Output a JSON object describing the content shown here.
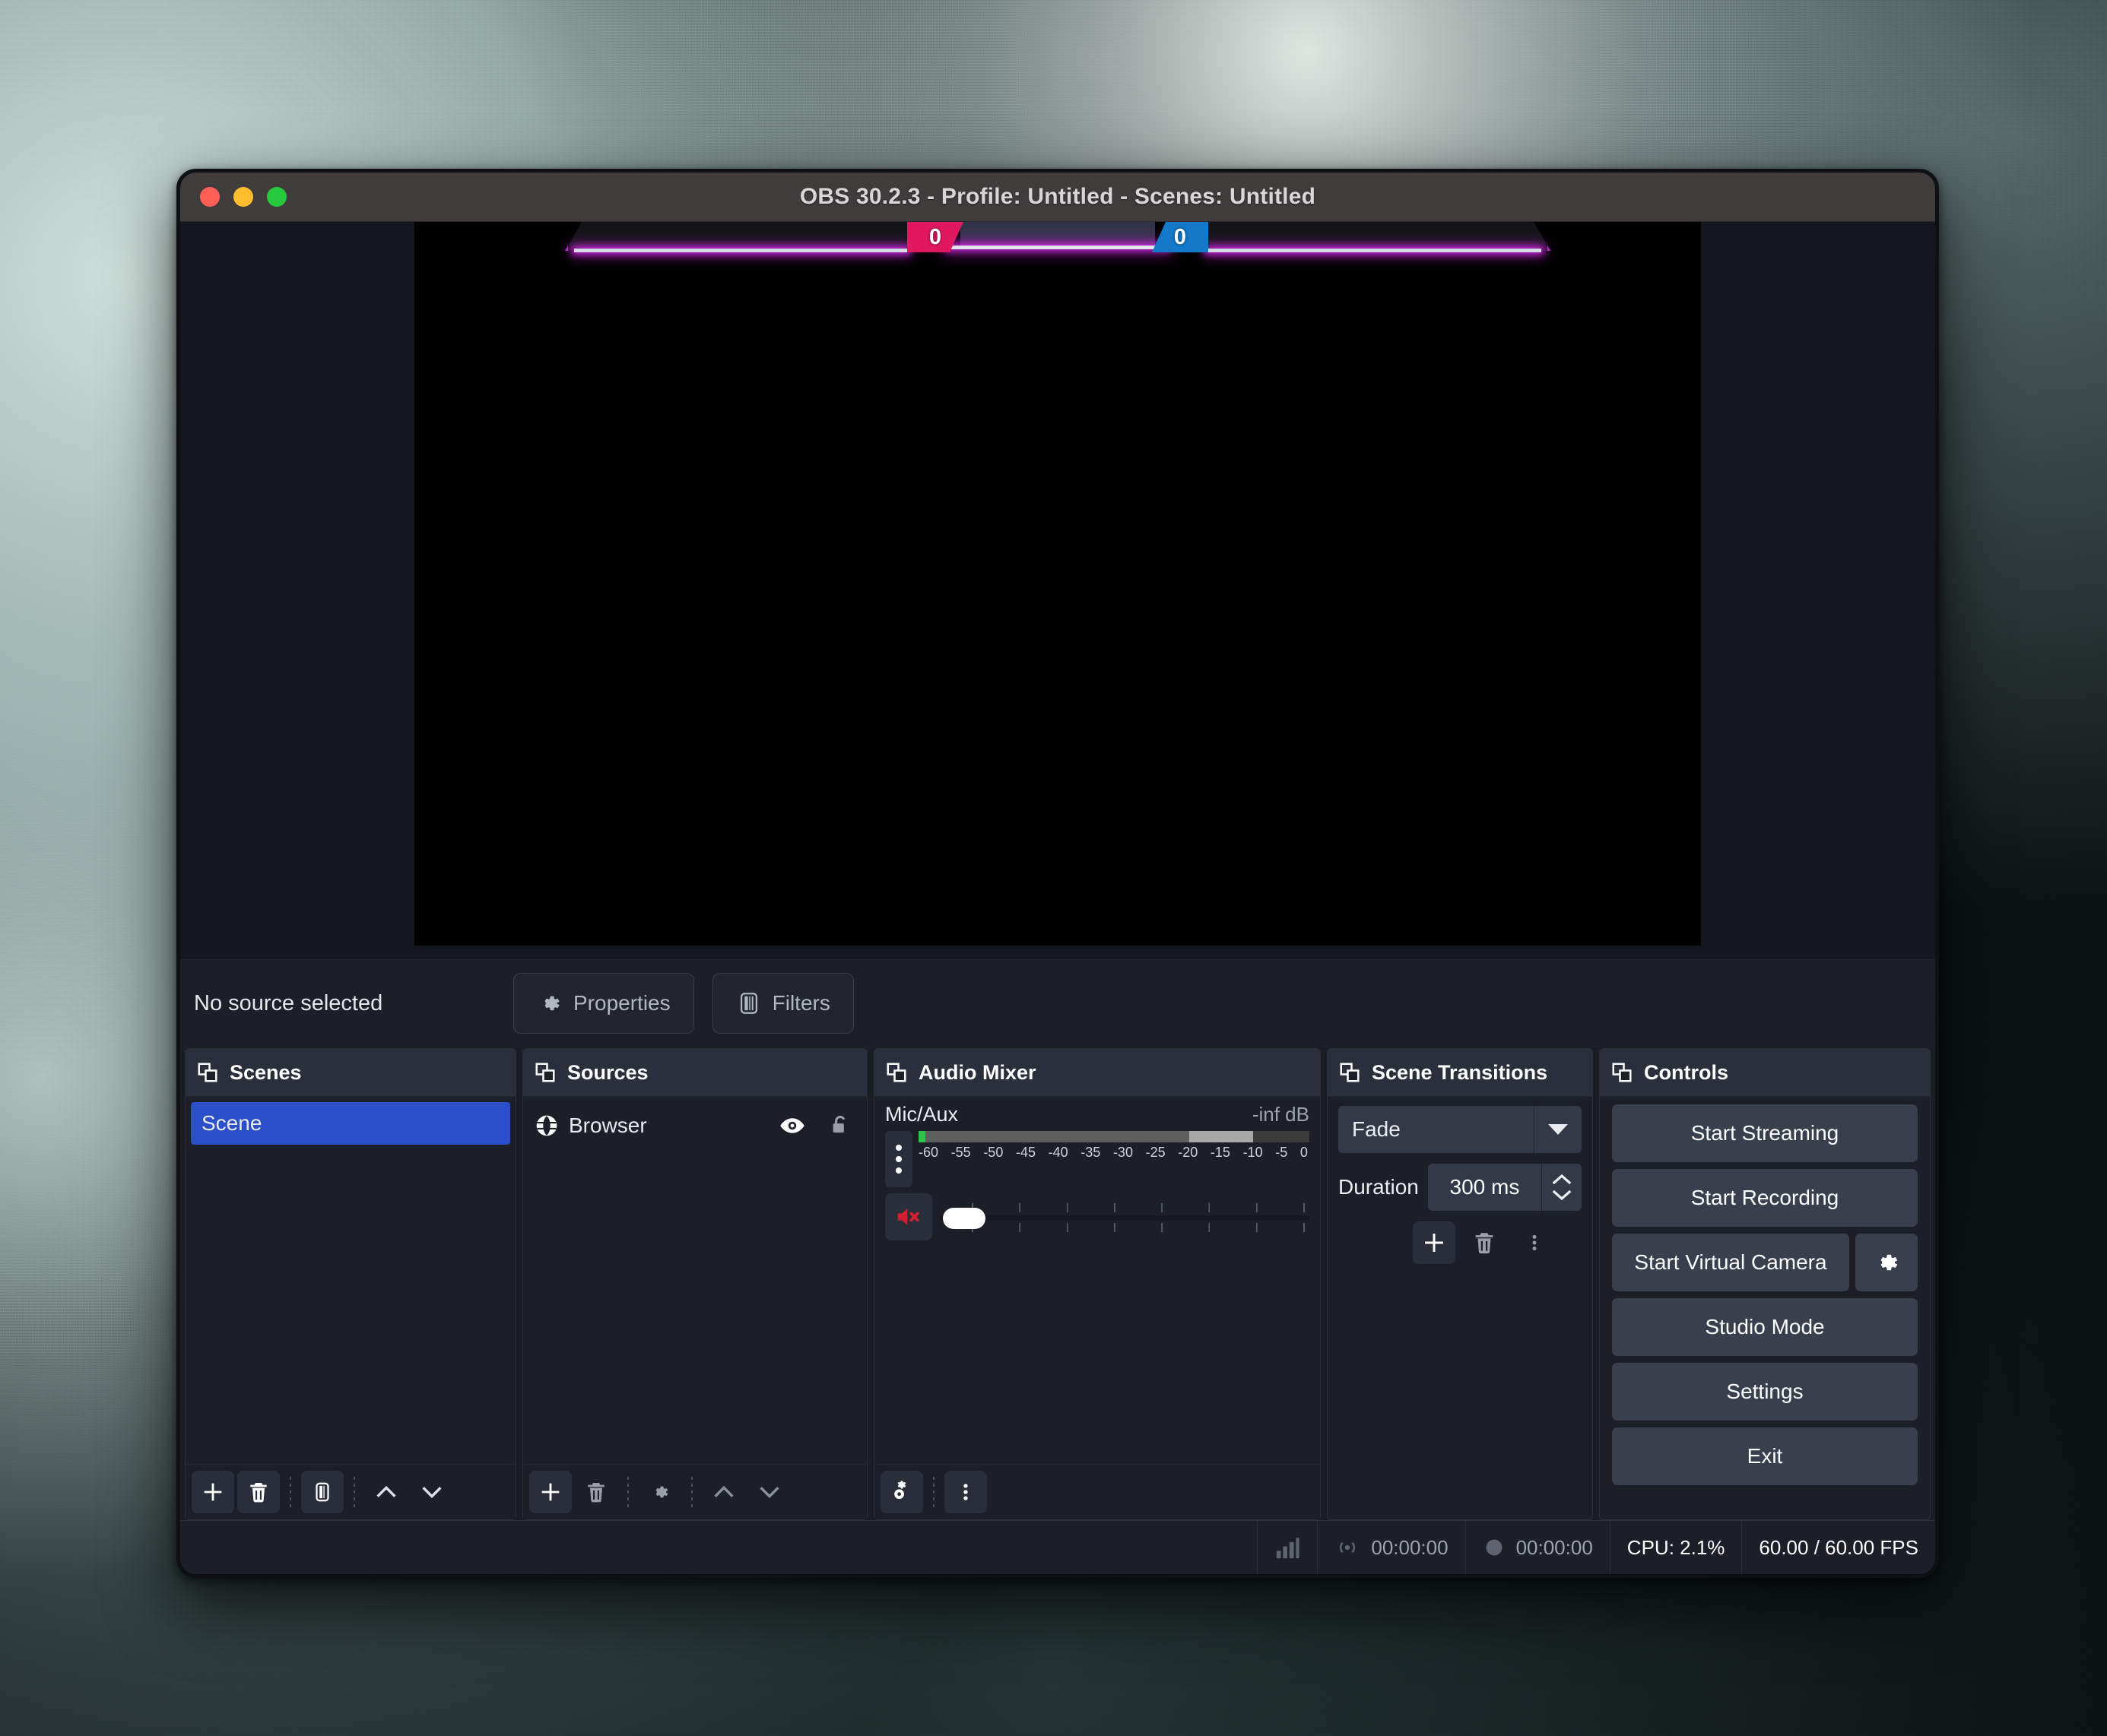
{
  "window": {
    "title": "OBS 30.2.3 - Profile: Untitled - Scenes: Untitled",
    "traffic_lights": [
      {
        "name": "close",
        "color": "#ff5f56"
      },
      {
        "name": "minimize",
        "color": "#ffbd2e"
      },
      {
        "name": "zoom",
        "color": "#27c93f"
      }
    ]
  },
  "preview": {
    "scoreboard": {
      "left_score": "0",
      "right_score": "0",
      "left_color": "#e0185f",
      "right_color": "#1479c9",
      "glow_color": "#c724d8"
    }
  },
  "source_row": {
    "status": "No source selected",
    "properties_label": "Properties",
    "filters_label": "Filters"
  },
  "scenes": {
    "title": "Scenes",
    "items": [
      {
        "label": "Scene",
        "selected": true
      }
    ],
    "toolbar": [
      "add",
      "remove",
      "filters",
      "move-up",
      "move-down"
    ]
  },
  "sources": {
    "title": "Sources",
    "items": [
      {
        "label": "Browser",
        "icon": "globe-icon",
        "visible": true,
        "locked": false
      }
    ],
    "toolbar": [
      "add",
      "remove",
      "properties",
      "move-up",
      "move-down"
    ]
  },
  "audio_mixer": {
    "title": "Audio Mixer",
    "tracks": [
      {
        "name": "Mic/Aux",
        "level": "-inf dB",
        "muted": true,
        "scale": [
          "-60",
          "-55",
          "-50",
          "-45",
          "-40",
          "-35",
          "-30",
          "-25",
          "-20",
          "-15",
          "-10",
          "-5",
          "0"
        ]
      }
    ],
    "toolbar": [
      "advanced-audio-properties",
      "menu"
    ]
  },
  "scene_transitions": {
    "title": "Scene Transitions",
    "transition": "Fade",
    "duration_label": "Duration",
    "duration_value": "300 ms",
    "toolbar": [
      "add",
      "remove",
      "menu"
    ]
  },
  "controls": {
    "title": "Controls",
    "buttons": [
      {
        "label": "Start Streaming"
      },
      {
        "label": "Start Recording"
      },
      {
        "label": "Start Virtual Camera",
        "has_settings": true
      },
      {
        "label": "Studio Mode"
      },
      {
        "label": "Settings"
      },
      {
        "label": "Exit"
      }
    ]
  },
  "statusbar": {
    "stream_time": "00:00:00",
    "record_time": "00:00:00",
    "cpu": "CPU: 2.1%",
    "fps": "60.00 / 60.00 FPS"
  }
}
